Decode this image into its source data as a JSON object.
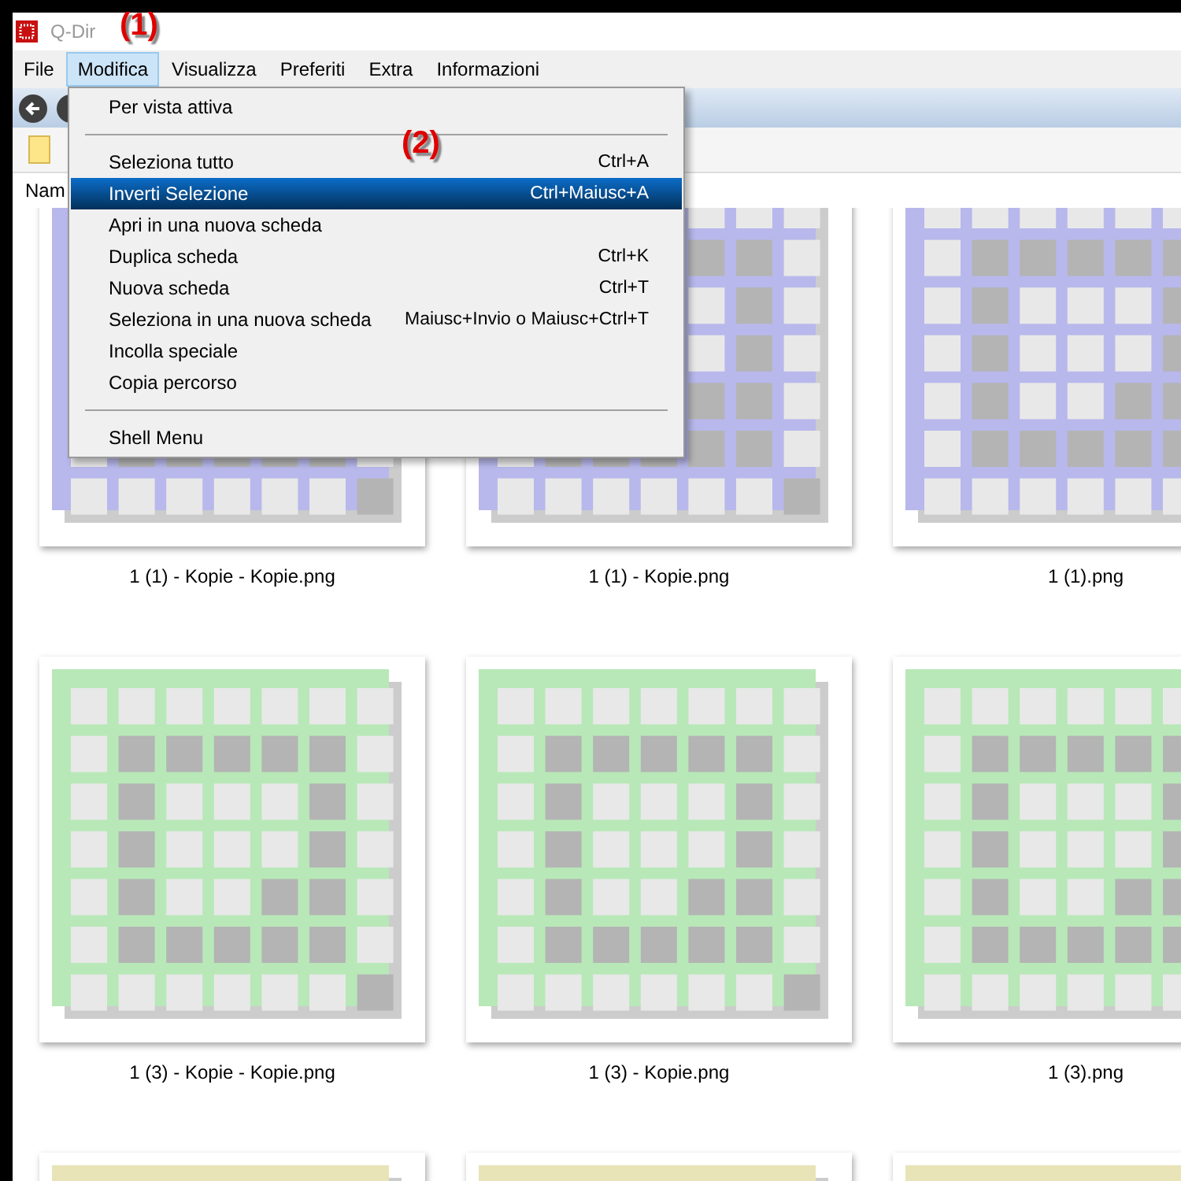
{
  "window": {
    "title": "Q-Dir"
  },
  "annotations": [
    {
      "text": "(1)"
    },
    {
      "text": "(2)"
    }
  ],
  "menu_bar": [
    {
      "label": "File",
      "selected": false
    },
    {
      "label": "Modifica",
      "selected": true
    },
    {
      "label": "Visualizza",
      "selected": false
    },
    {
      "label": "Preferiti",
      "selected": false
    },
    {
      "label": "Extra",
      "selected": false
    },
    {
      "label": "Informazioni",
      "selected": false
    }
  ],
  "list_header": {
    "column_1": "Nam"
  },
  "menu": [
    {
      "kind": "item",
      "label": "Per vista attiva",
      "selected": false
    },
    {
      "kind": "separator"
    },
    {
      "kind": "item",
      "label": "Seleziona tutto",
      "shortcut": "Ctrl+A",
      "selected": false
    },
    {
      "kind": "item",
      "label": "Inverti Selezione",
      "shortcut": "Ctrl+Maiusc+A",
      "selected": true
    },
    {
      "kind": "item",
      "label": "Apri in una nuova scheda",
      "selected": false
    },
    {
      "kind": "item",
      "label": "Duplica scheda",
      "shortcut": "Ctrl+K",
      "selected": false
    },
    {
      "kind": "item",
      "label": "Nuova scheda",
      "shortcut": "Ctrl+T",
      "selected": false
    },
    {
      "kind": "item",
      "label": "Seleziona in una nuova scheda",
      "shortcut": "Maiusc+Invio o Maiusc+Ctrl+T",
      "selected": false
    },
    {
      "kind": "item",
      "label": "Incolla speciale",
      "selected": false
    },
    {
      "kind": "item",
      "label": "Copia percorso",
      "selected": false
    },
    {
      "kind": "separator"
    },
    {
      "kind": "item",
      "label": "Shell Menu",
      "selected": false
    }
  ],
  "files": [
    {
      "name": "1 (1) - Kopie - Kopie.png",
      "color": "#b8b8ec"
    },
    {
      "name": "1 (1) - Kopie.png",
      "color": "#b8b8ec"
    },
    {
      "name": "1 (1).png",
      "color": "#b8b8ec"
    },
    {
      "name": "1 (3) - Kopie - Kopie.png",
      "color": "#b8e8b8"
    },
    {
      "name": "1 (3) - Kopie.png",
      "color": "#b8e8b8"
    },
    {
      "name": "1 (3).png",
      "color": "#b8e8b8"
    },
    {
      "color": "#e8e4b8"
    },
    {
      "color": "#e8e4b8"
    },
    {
      "color": "#e8e4b8"
    }
  ]
}
